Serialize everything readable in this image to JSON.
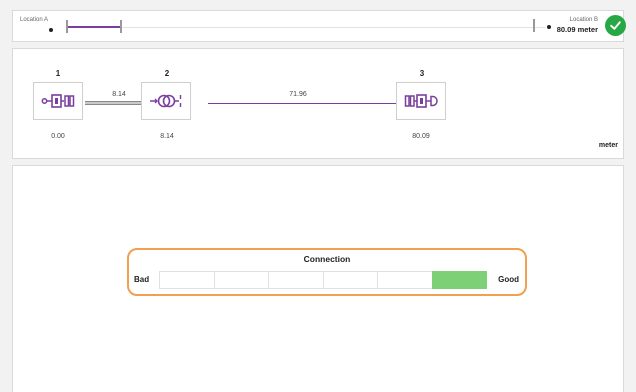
{
  "route": {
    "location_a": "Location A",
    "location_b": "Location B",
    "distance": "80.09 meter",
    "ok_icon": "check-icon"
  },
  "devices": {
    "items": [
      {
        "number": "1",
        "value": "0.00",
        "icon": "ptp-device-a-icon"
      },
      {
        "number": "2",
        "value": "8.14",
        "icon": "repeater-icon"
      },
      {
        "number": "3",
        "value": "80.09",
        "icon": "ptp-device-b-icon"
      }
    ],
    "links": [
      "8.14",
      "71.96"
    ],
    "unit": "meter",
    "accent_color": "#7a3f9d"
  },
  "connection": {
    "title": "Connection",
    "bad_label": "Bad",
    "good_label": "Good",
    "segments": 6,
    "level": 6,
    "highlight_color": "#f0a050",
    "bar_color": "#7ed077"
  }
}
